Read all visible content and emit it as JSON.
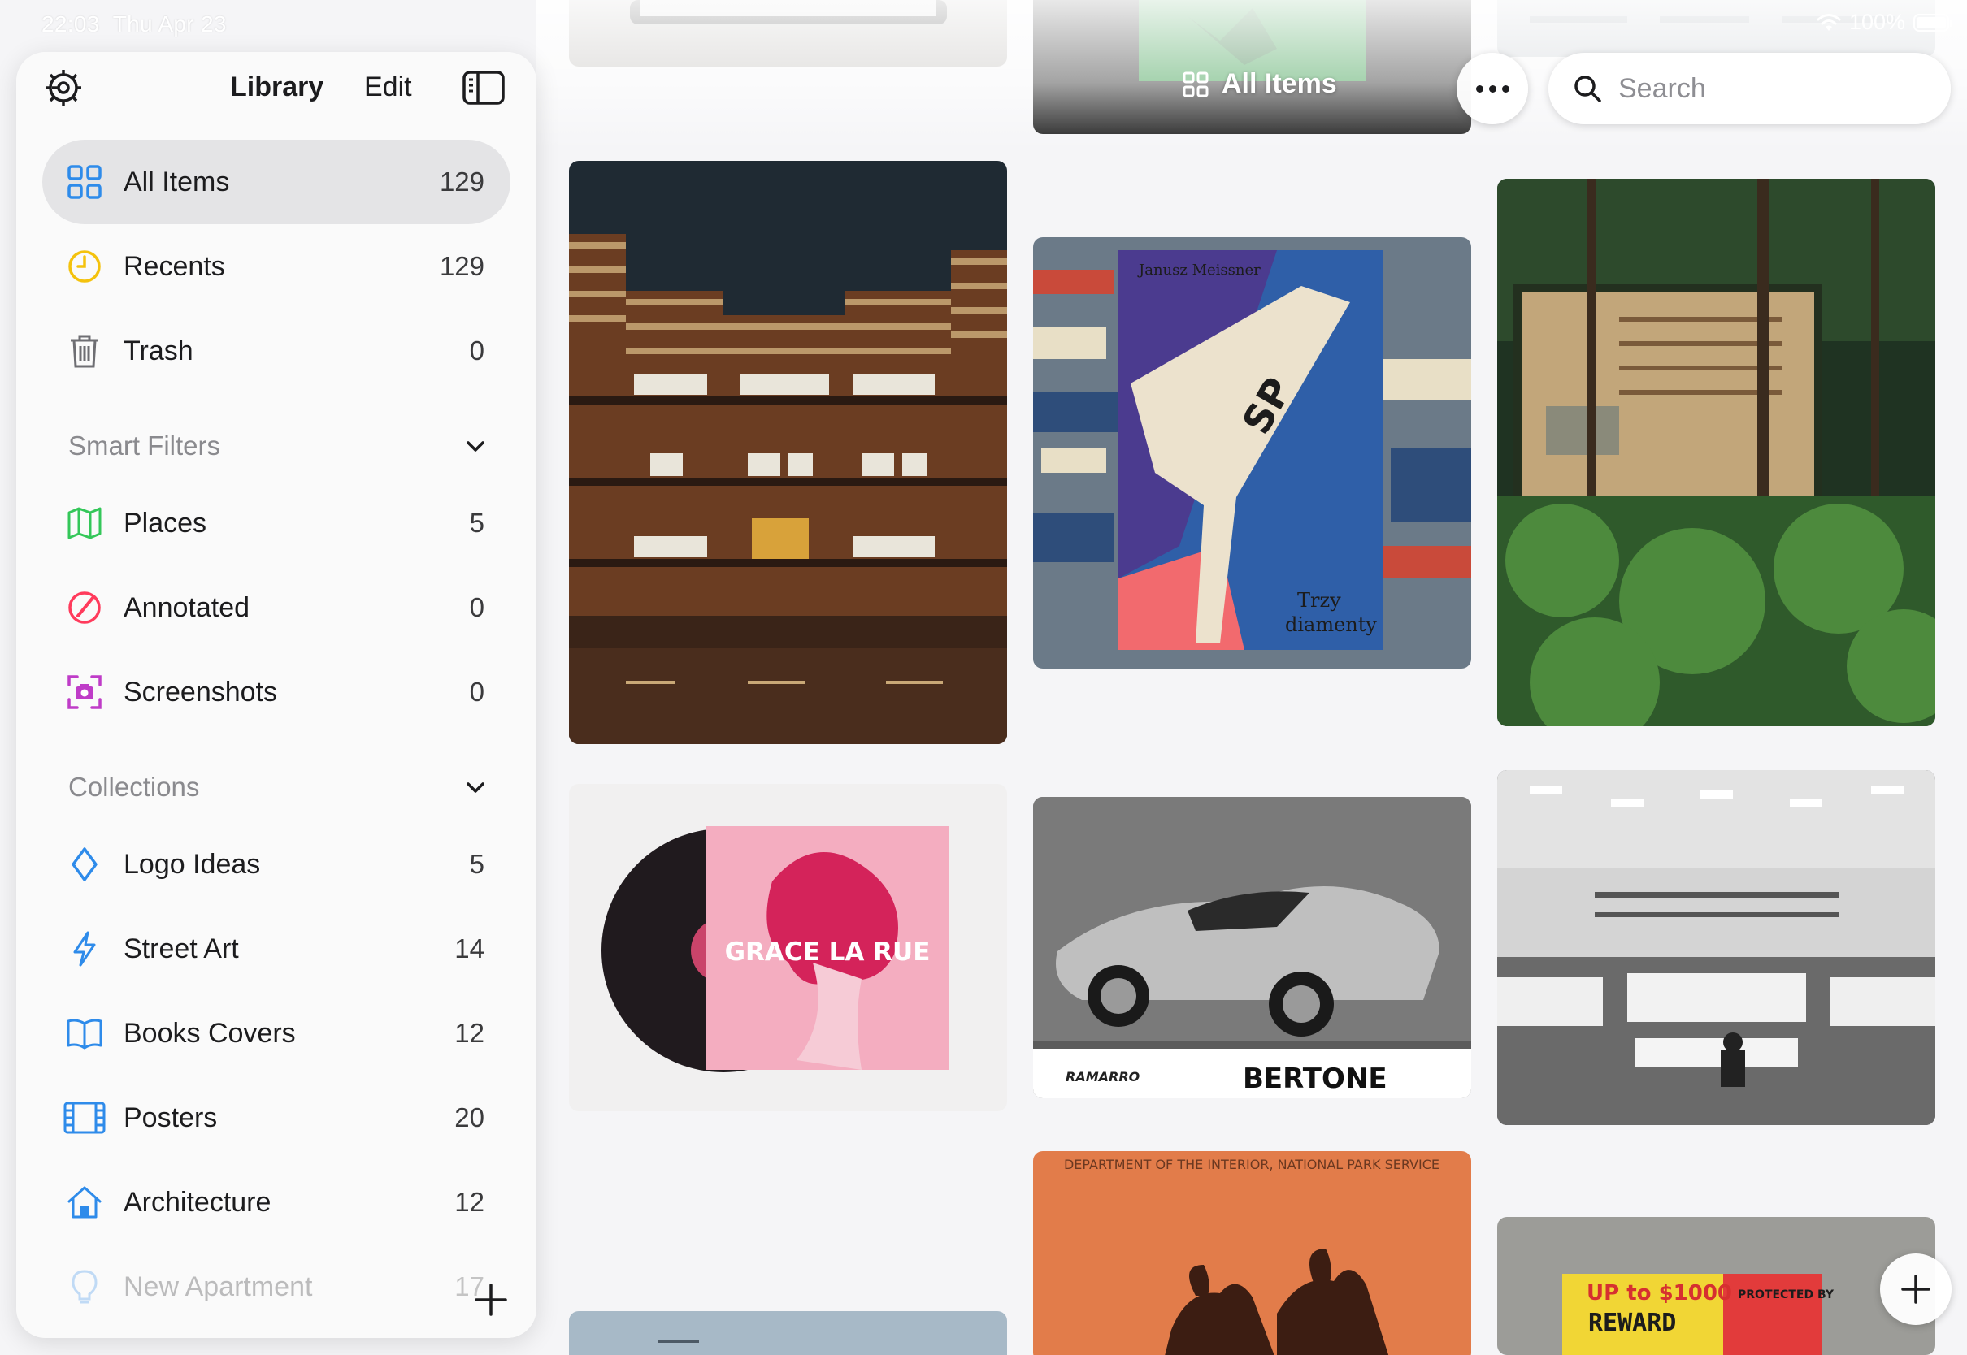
{
  "status_bar": {
    "time": "22:03",
    "date": "Thu Apr 23",
    "battery": "100%",
    "wifi_icon": "wifi-icon"
  },
  "toolbar": {
    "title": "All Items",
    "title_icon": "grid-icon",
    "more_icon": "ellipsis-icon",
    "search_placeholder": "Search"
  },
  "sidebar": {
    "title": "Library",
    "edit_label": "Edit",
    "settings_icon": "gear-icon",
    "toggle_icon": "sidebar-toggle-icon",
    "items": [
      {
        "label": "All Items",
        "count": "129",
        "icon": "grid-icon",
        "color": "#2e8bea"
      },
      {
        "label": "Recents",
        "count": "129",
        "icon": "clock-icon",
        "color": "#f4c20d"
      },
      {
        "label": "Trash",
        "count": "0",
        "icon": "trash-icon",
        "color": "#6e6e73"
      }
    ],
    "smart_filters": {
      "title": "Smart Filters",
      "items": [
        {
          "label": "Places",
          "count": "5",
          "icon": "map-icon",
          "color": "#34c759"
        },
        {
          "label": "Annotated",
          "count": "0",
          "icon": "annotate-icon",
          "color": "#ff3b5c"
        },
        {
          "label": "Screenshots",
          "count": "0",
          "icon": "screenshot-icon",
          "color": "#bf3cc8"
        }
      ]
    },
    "collections": {
      "title": "Collections",
      "items": [
        {
          "label": "Logo Ideas",
          "count": "5",
          "icon": "diamond-icon",
          "color": "#2e8bea"
        },
        {
          "label": "Street Art",
          "count": "14",
          "icon": "bolt-icon",
          "color": "#2e8bea"
        },
        {
          "label": "Books Covers",
          "count": "12",
          "icon": "book-icon",
          "color": "#2e8bea"
        },
        {
          "label": "Posters",
          "count": "20",
          "icon": "film-icon",
          "color": "#2e8bea"
        },
        {
          "label": "Architecture",
          "count": "12",
          "icon": "house-icon",
          "color": "#2e8bea"
        },
        {
          "label": "New Apartment",
          "count": "17",
          "icon": "bulb-icon",
          "color": "#2e8bea"
        }
      ]
    }
  },
  "gallery": {
    "poster_texts": {
      "grace": "GRACE LA RUE",
      "bertone_brand": "BERTONE",
      "bertone_model": "RAMARRO",
      "book_author": "Janusz Meissner",
      "book_title_1": "Trzy",
      "book_title_2": "diamenty",
      "book_plane": "SP",
      "nps": "DEPARTMENT OF THE INTERIOR, NATIONAL PARK SERVICE",
      "reward_1": "UP to $1000",
      "reward_2": "REWARD",
      "protected": "PROTECTED BY"
    }
  }
}
